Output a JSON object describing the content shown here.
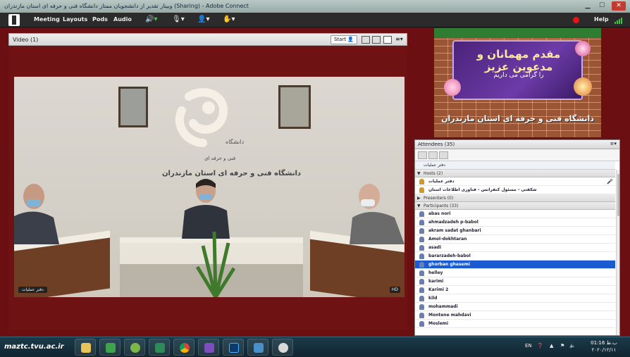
{
  "window": {
    "title": "وبینار تقدیر از دانشجویان ممتاز دانشگاه فنی و حرفه ای استان مازندران (Sharing) - Adobe Connect",
    "minimize": "▁",
    "maximize": "☐",
    "close": "✕"
  },
  "menubar": {
    "items": [
      "Meeting",
      "Layouts",
      "Pods",
      "Audio"
    ],
    "help": "Help",
    "speaker_icon": "speaker-icon",
    "mic_icon": "microphone-icon",
    "camera_icon": "camera-icon",
    "hand_icon": "raise-hand-icon"
  },
  "video_pod": {
    "title": "Video",
    "count": "(1)",
    "start_label": "Start",
    "name_tag": "دفتر عملیات",
    "hd_badge": "HD"
  },
  "room": {
    "logo_caption": "دانشگاه فنی و حرفه ای استان مازندران",
    "logo_caption_small": "دانشگاه",
    "logo_caption_mid": "فنی و حرفه ای"
  },
  "banner": {
    "line1": "مقدم مهمانان و مدعوین عزیز",
    "line2": "را گرامی می داریم",
    "line3": "دانشگاه فنی و حرفه ای استان مازندران"
  },
  "attendees": {
    "title": "Attendees",
    "count": "(35)",
    "me": "دفتر عملیات",
    "hosts_label": "Hosts (2)",
    "presenters_label": "Presenters (0)",
    "participants_label": "Participants (33)",
    "hosts": [
      "دفتر عملیات",
      "شکفتی - مسئول کنفرانس - فناوری اطلاعات استان"
    ],
    "participants": [
      "abas nori",
      "ahmadzadeh p-babol",
      "akram sadat ghanbari",
      "Amol-dokhtaran",
      "asadi",
      "bararzadeh-babol",
      "ghorban ghasemi",
      "helley",
      "karimi",
      "Karimi 2",
      "kild",
      "mohammadi",
      "Montene mahdavi",
      "Moslemi"
    ],
    "selected_index": 6
  },
  "taskbar": {
    "watermark": "maztc.tvu.ac.ir",
    "lang": "EN",
    "time": "01:16 ب.ظ",
    "date": "۲۰۲۰/۱۲/۱۱"
  },
  "colors": {
    "workspace": "#6b0f13",
    "selection": "#1a5bd1",
    "desktop": "#0d6b33"
  }
}
